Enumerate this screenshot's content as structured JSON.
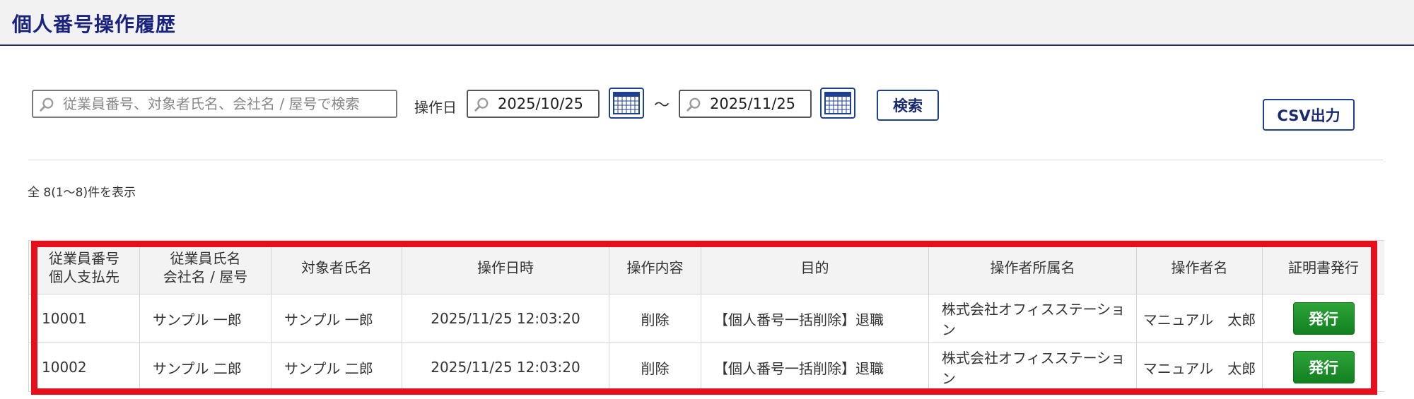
{
  "header": {
    "title": "個人番号操作履歴"
  },
  "search": {
    "placeholder": "従業員番号、対象者氏名、会社名 / 屋号で検索",
    "value": ""
  },
  "filter": {
    "date_label": "操作日",
    "date_from": "2025/10/25",
    "separator": "～",
    "date_to": "2025/11/25",
    "search_button": "検索",
    "csv_button": "CSV出力"
  },
  "summary": {
    "count_text": "全 8(1～8)件を表示"
  },
  "table": {
    "headers": [
      {
        "line1": "従業員番号",
        "line2": "個人支払先"
      },
      {
        "line1": "従業員氏名",
        "line2": "会社名 / 屋号"
      },
      {
        "line1": "対象者氏名",
        "line2": ""
      },
      {
        "line1": "操作日時",
        "line2": ""
      },
      {
        "line1": "操作内容",
        "line2": ""
      },
      {
        "line1": "目的",
        "line2": ""
      },
      {
        "line1": "操作者所属名",
        "line2": ""
      },
      {
        "line1": "操作者名",
        "line2": ""
      },
      {
        "line1": "証明書発行",
        "line2": ""
      }
    ],
    "rows": [
      {
        "employee_no": "10001",
        "employee_name": "サンプル 一郎",
        "target_name": "サンプル 一郎",
        "datetime": "2025/11/25 12:03:20",
        "operation": "削除",
        "purpose": "【個人番号一括削除】退職",
        "operator_org": "株式会社オフィスステーション",
        "operator_name": "マニュアル　太郎",
        "issue_label": "発行"
      },
      {
        "employee_no": "10002",
        "employee_name": "サンプル 二郎",
        "target_name": "サンプル 二郎",
        "datetime": "2025/11/25 12:03:20",
        "operation": "削除",
        "purpose": "【個人番号一括削除】退職",
        "operator_org": "株式会社オフィスステーション",
        "operator_name": "マニュアル　太郎",
        "issue_label": "発行"
      }
    ]
  },
  "colors": {
    "title": "#1a237e",
    "highlight": "#e5101b",
    "issue_button": "#12801f",
    "button_border": "#1f3f8f"
  },
  "icons": {
    "search": "magnifier-icon",
    "calendar": "calendar-icon"
  }
}
